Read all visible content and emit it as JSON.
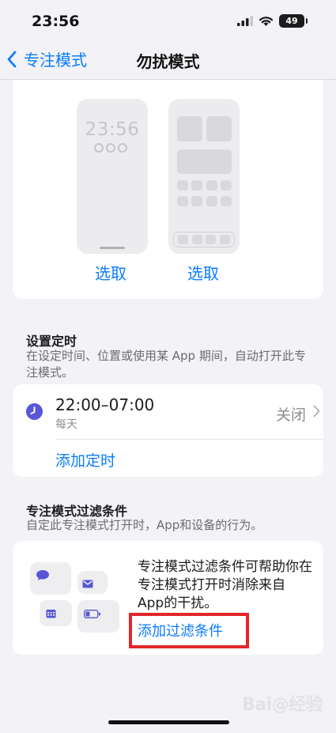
{
  "status_bar": {
    "time": "23:56",
    "battery_level": "49"
  },
  "nav": {
    "back_label": "专注模式",
    "title": "勿扰模式"
  },
  "screens": {
    "lock_screen_time": "23:56",
    "lock_select_label": "选取",
    "home_select_label": "选取"
  },
  "schedule": {
    "section_title": "设置定时",
    "section_description": "在设定时间、位置或使用某 App 期间，自动打开此专注模式。",
    "item": {
      "time_range": "22:00–07:00",
      "repeat": "每天",
      "status": "关闭"
    },
    "add_label": "添加定时"
  },
  "filters": {
    "section_title": "专注模式过滤条件",
    "section_description": "自定此专注模式打开时，App和设备的行为。",
    "card_description": "专注模式过滤条件可帮助你在专注模式打开时消除来自 App的干扰。",
    "add_label": "添加过滤条件"
  },
  "watermark": "Bai@经验",
  "colors": {
    "accent": "#0a7cff",
    "clock_icon": "#5856d6",
    "highlight": "#e3262a",
    "background": "#f2f2f7"
  }
}
